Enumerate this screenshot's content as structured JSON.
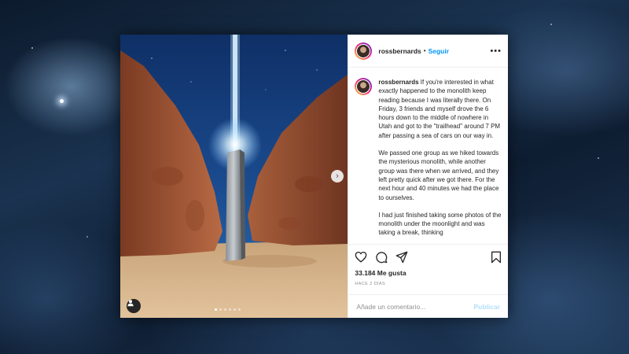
{
  "post": {
    "username": "rossbernards",
    "follow_label": "Seguir",
    "more_icon": "more-icon",
    "caption": {
      "username": "rossbernards",
      "paragraphs": [
        "If you're interested in what exactly happened to the monolith keep reading because I was literally there. On Friday, 3 friends and myself drove the 6 hours down to the middle of nowhere in Utah and got to the \"trailhead\" around 7 PM after passing a sea of cars on our way in.",
        "We passed one group as we hiked towards the mysterious monolith, while another group was there when we arrived, and they left pretty quick after we got there. For the next hour and 40 minutes we had the place to ourselves.",
        "I had just finished taking some photos of the monolith under the moonlight and was taking a break, thinking"
      ]
    },
    "likes": "33.184 Me gusta",
    "timestamp": "HACE 2 DÍAS",
    "comment_placeholder": "Añade un comentario...",
    "publish_label": "Publicar",
    "carousel": {
      "count": 6,
      "active_index": 0
    },
    "colors": {
      "accent": "#0095f6",
      "publish_disabled": "#b2dffc",
      "text": "#262626",
      "muted": "#8e8e8e"
    }
  }
}
